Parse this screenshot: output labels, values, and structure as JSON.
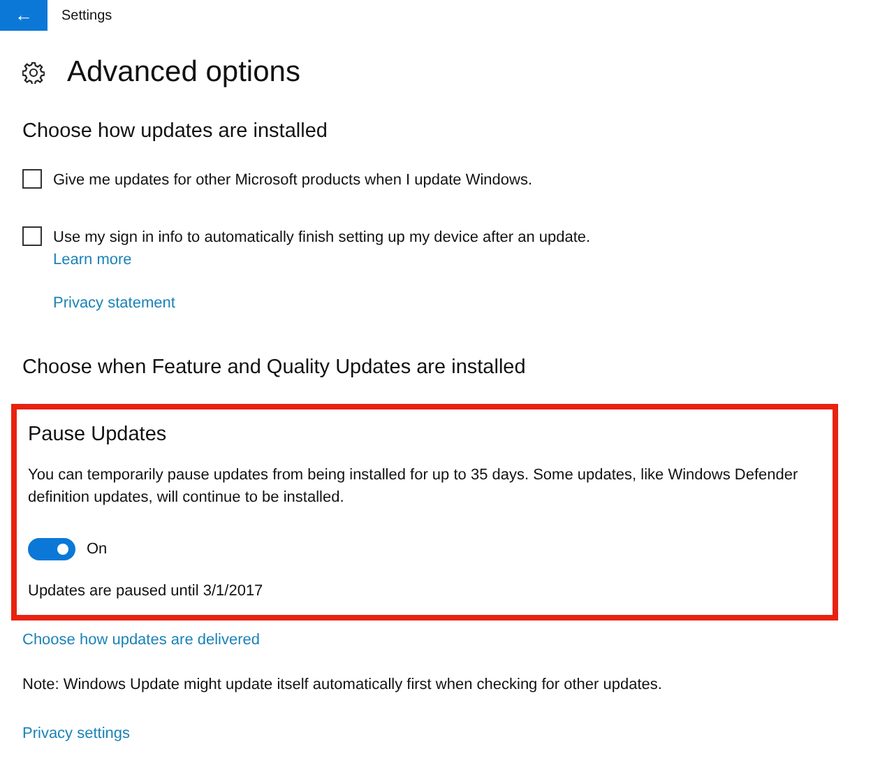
{
  "window": {
    "title": "Settings",
    "back_button": "←"
  },
  "page": {
    "title": "Advanced options"
  },
  "install_section": {
    "heading": "Choose how updates are installed",
    "options": [
      {
        "label": "Give me updates for other Microsoft products when I update Windows.",
        "checked": false
      },
      {
        "label": "Use my sign in info to automatically finish setting up my device after an update.",
        "checked": false,
        "link": "Learn more"
      }
    ],
    "privacy_link": "Privacy statement"
  },
  "when_section": {
    "heading": "Choose when Feature and Quality Updates are installed"
  },
  "pause_section": {
    "highlighted": true,
    "heading": "Pause Updates",
    "description": "You can temporarily pause updates from being installed for up to 35 days. Some updates, like Windows Defender definition updates, will continue to be installed.",
    "toggle": {
      "on": true,
      "label": "On"
    },
    "status": "Updates are paused until 3/1/2017"
  },
  "delivery_link": "Choose how updates are delivered",
  "note": "Note: Windows Update might update itself automatically first when checking for other updates.",
  "privacy_settings_link": "Privacy settings"
}
